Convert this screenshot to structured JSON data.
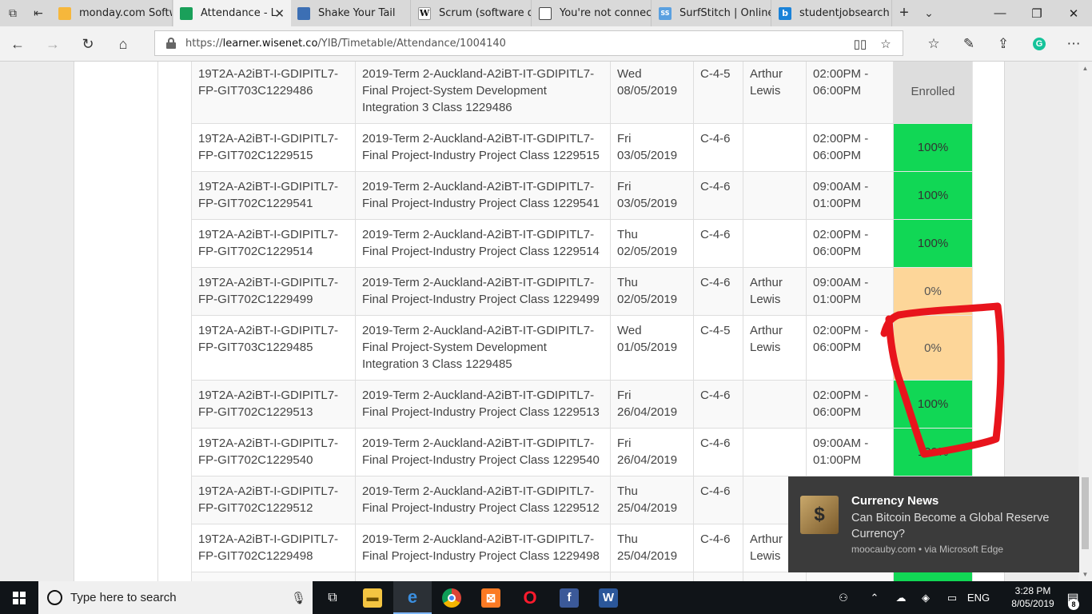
{
  "browser": {
    "tabs": [
      {
        "label": "monday.com Softw",
        "favicon": "monday-favicon-icon",
        "color": "#f6b73c"
      },
      {
        "label": "Attendance - L",
        "favicon": "wisenet-favicon-icon",
        "color": "#1aa05a",
        "active": true
      },
      {
        "label": "Shake Your Tail",
        "favicon": "keyboard-favicon-icon",
        "color": "#3c6fb4"
      },
      {
        "label": "Scrum (software de",
        "favicon": "wikipedia-favicon-icon",
        "color": "#ffffff"
      },
      {
        "label": "You're not connect",
        "favicon": "page-favicon-icon",
        "color": "#ffffff"
      },
      {
        "label": "SurfStitch | Online",
        "favicon": "surfstitch-favicon-icon",
        "color": "#5aa0e0"
      },
      {
        "label": "studentjobsearch -",
        "favicon": "bing-favicon-icon",
        "color": "#1a82d8"
      }
    ],
    "tab_close_glyph": "✕",
    "new_tab_glyph": "+",
    "tab_list_glyph": "⌄",
    "url_prefix": "https://",
    "url_host": "learner.wisenet.co",
    "url_path": "/YIB/Timetable/Attendance/1004140"
  },
  "table": {
    "rows": [
      {
        "code1": "19T2A-A2iBT-I-GDIPITL7-",
        "code2": "FP-GIT703C1229486",
        "desc1": "2019-Term 2-Auckland-A2iBT-IT-GDIPITL7-",
        "desc2": "Final Project-System Development",
        "desc3": "Integration 3 Class 1229486",
        "day": "Wed",
        "date": "08/05/2019",
        "room": "C-4-5",
        "tutor1": "Arthur",
        "tutor2": "Lewis",
        "time1": "02:00PM -",
        "time2": "06:00PM",
        "status": "Enrolled",
        "kind": "enrolled"
      },
      {
        "code1": "19T2A-A2iBT-I-GDIPITL7-",
        "code2": "FP-GIT702C1229515",
        "desc1": "2019-Term 2-Auckland-A2iBT-IT-GDIPITL7-",
        "desc2": "Final Project-Industry Project Class 1229515",
        "desc3": "",
        "day": "Fri",
        "date": "03/05/2019",
        "room": "C-4-6",
        "tutor1": "",
        "tutor2": "",
        "time1": "02:00PM -",
        "time2": "06:00PM",
        "status": "100%",
        "kind": "full"
      },
      {
        "code1": "19T2A-A2iBT-I-GDIPITL7-",
        "code2": "FP-GIT702C1229541",
        "desc1": "2019-Term 2-Auckland-A2iBT-IT-GDIPITL7-",
        "desc2": "Final Project-Industry Project Class 1229541",
        "desc3": "",
        "day": "Fri",
        "date": "03/05/2019",
        "room": "C-4-6",
        "tutor1": "",
        "tutor2": "",
        "time1": "09:00AM -",
        "time2": "01:00PM",
        "status": "100%",
        "kind": "full"
      },
      {
        "code1": "19T2A-A2iBT-I-GDIPITL7-",
        "code2": "FP-GIT702C1229514",
        "desc1": "2019-Term 2-Auckland-A2iBT-IT-GDIPITL7-",
        "desc2": "Final Project-Industry Project Class 1229514",
        "desc3": "",
        "day": "Thu",
        "date": "02/05/2019",
        "room": "C-4-6",
        "tutor1": "",
        "tutor2": "",
        "time1": "02:00PM -",
        "time2": "06:00PM",
        "status": "100%",
        "kind": "full"
      },
      {
        "code1": "19T2A-A2iBT-I-GDIPITL7-",
        "code2": "FP-GIT702C1229499",
        "desc1": "2019-Term 2-Auckland-A2iBT-IT-GDIPITL7-",
        "desc2": "Final Project-Industry Project Class 1229499",
        "desc3": "",
        "day": "Thu",
        "date": "02/05/2019",
        "room": "C-4-6",
        "tutor1": "Arthur",
        "tutor2": "Lewis",
        "time1": "09:00AM -",
        "time2": "01:00PM",
        "status": "0%",
        "kind": "zero"
      },
      {
        "code1": "19T2A-A2iBT-I-GDIPITL7-",
        "code2": "FP-GIT703C1229485",
        "desc1": "2019-Term 2-Auckland-A2iBT-IT-GDIPITL7-",
        "desc2": "Final Project-System Development",
        "desc3": "Integration 3 Class 1229485",
        "day": "Wed",
        "date": "01/05/2019",
        "room": "C-4-5",
        "tutor1": "Arthur",
        "tutor2": "Lewis",
        "time1": "02:00PM -",
        "time2": "06:00PM",
        "status": "0%",
        "kind": "zero"
      },
      {
        "code1": "19T2A-A2iBT-I-GDIPITL7-",
        "code2": "FP-GIT702C1229513",
        "desc1": "2019-Term 2-Auckland-A2iBT-IT-GDIPITL7-",
        "desc2": "Final Project-Industry Project Class 1229513",
        "desc3": "",
        "day": "Fri",
        "date": "26/04/2019",
        "room": "C-4-6",
        "tutor1": "",
        "tutor2": "",
        "time1": "02:00PM -",
        "time2": "06:00PM",
        "status": "100%",
        "kind": "full"
      },
      {
        "code1": "19T2A-A2iBT-I-GDIPITL7-",
        "code2": "FP-GIT702C1229540",
        "desc1": "2019-Term 2-Auckland-A2iBT-IT-GDIPITL7-",
        "desc2": "Final Project-Industry Project Class 1229540",
        "desc3": "",
        "day": "Fri",
        "date": "26/04/2019",
        "room": "C-4-6",
        "tutor1": "",
        "tutor2": "",
        "time1": "09:00AM -",
        "time2": "01:00PM",
        "status": "100%",
        "kind": "full"
      },
      {
        "code1": "19T2A-A2iBT-I-GDIPITL7-",
        "code2": "FP-GIT702C1229512",
        "desc1": "2019-Term 2-Auckland-A2iBT-IT-GDIPITL7-",
        "desc2": "Final Project-Industry Project Class 1229512",
        "desc3": "",
        "day": "Thu",
        "date": "25/04/2019",
        "room": "C-4-6",
        "tutor1": "",
        "tutor2": "",
        "time1": "",
        "time2": "",
        "status": "",
        "kind": "full"
      },
      {
        "code1": "19T2A-A2iBT-I-GDIPITL7-",
        "code2": "FP-GIT702C1229498",
        "desc1": "2019-Term 2-Auckland-A2iBT-IT-GDIPITL7-",
        "desc2": "Final Project-Industry Project Class 1229498",
        "desc3": "",
        "day": "Thu",
        "date": "25/04/2019",
        "room": "C-4-6",
        "tutor1": "Arthur",
        "tutor2": "Lewis",
        "time1": "",
        "time2": "",
        "status": "",
        "kind": "full"
      },
      {
        "code1": "",
        "code2": "",
        "desc1": "",
        "desc2": "",
        "desc3": "",
        "day": "",
        "date": "",
        "room": "",
        "tutor1": "",
        "tutor2": "",
        "time1": "",
        "time2": "",
        "status": "",
        "kind": "full"
      }
    ],
    "status_colors": {
      "enrolled": "#dddddd",
      "full": "#11d755",
      "zero": "#fdd699"
    }
  },
  "annotation": {
    "color": "#e8141c"
  },
  "notification": {
    "title": "Currency News",
    "body": "Can Bitcoin Become a Global Reserve Currency?",
    "source": "moocauby.com • via Microsoft Edge",
    "image_icon": "money-bag-icon"
  },
  "taskbar": {
    "search_placeholder": "Type here to search",
    "language": "ENG",
    "time": "3:28 PM",
    "date": "8/05/2019",
    "notification_count": "8"
  }
}
